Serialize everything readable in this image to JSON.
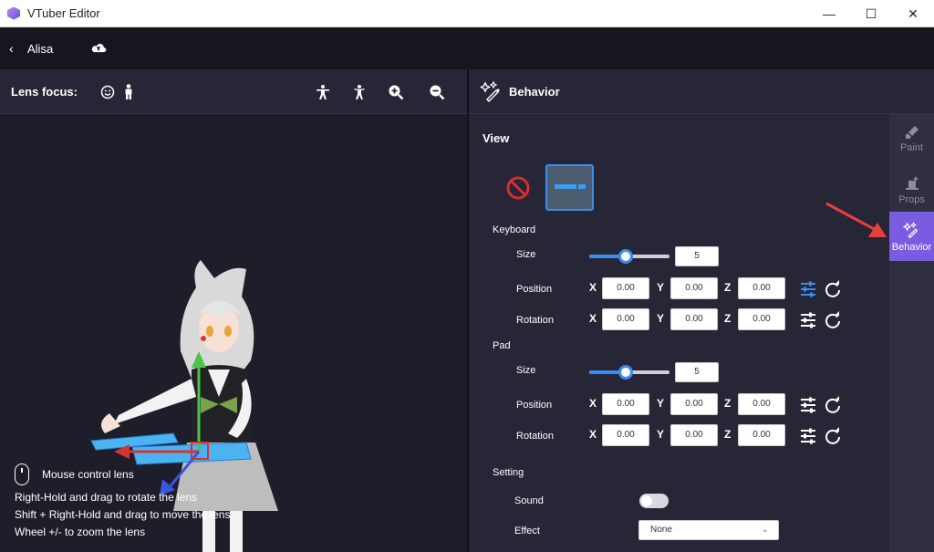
{
  "window": {
    "title": "VTuber Editor",
    "minimize": "—",
    "maximize": "☐",
    "close": "✕"
  },
  "topnav": {
    "back_glyph": "‹",
    "user": "Alisa"
  },
  "lens": {
    "title": "Lens focus:",
    "hints": {
      "mouse": "Mouse control lens",
      "rotate": "Right-Hold and drag to rotate the lens",
      "move": "Shift + Right-Hold and drag to move the lens",
      "zoom": "Wheel +/- to zoom the lens"
    }
  },
  "behavior": {
    "title": "Behavior",
    "view_title": "View",
    "keyboard": {
      "title": "Keyboard",
      "size_label": "Size",
      "size_value": "5",
      "size_fraction": 0.45,
      "position_label": "Position",
      "rotation_label": "Rotation",
      "position": {
        "x": "0.00",
        "y": "0.00",
        "z": "0.00"
      },
      "rotation": {
        "x": "0.00",
        "y": "0.00",
        "z": "0.00"
      }
    },
    "pad": {
      "title": "Pad",
      "size_label": "Size",
      "size_value": "5",
      "size_fraction": 0.45,
      "position_label": "Position",
      "rotation_label": "Rotation",
      "position": {
        "x": "0.00",
        "y": "0.00",
        "z": "0.00"
      },
      "rotation": {
        "x": "0.00",
        "y": "0.00",
        "z": "0.00"
      }
    },
    "axes": {
      "x": "X",
      "y": "Y",
      "z": "Z"
    },
    "setting": {
      "title": "Setting",
      "sound_label": "Sound",
      "sound_on": false,
      "effect_label": "Effect",
      "effect_value": "None"
    }
  },
  "sidetabs": [
    {
      "label": "Paint"
    },
    {
      "label": "Props"
    },
    {
      "label": "Behavior"
    }
  ],
  "colors": {
    "accent": "#3b8cf0",
    "active_tab": "#7a5ce0",
    "annotation_arrow": "#e8413c"
  }
}
